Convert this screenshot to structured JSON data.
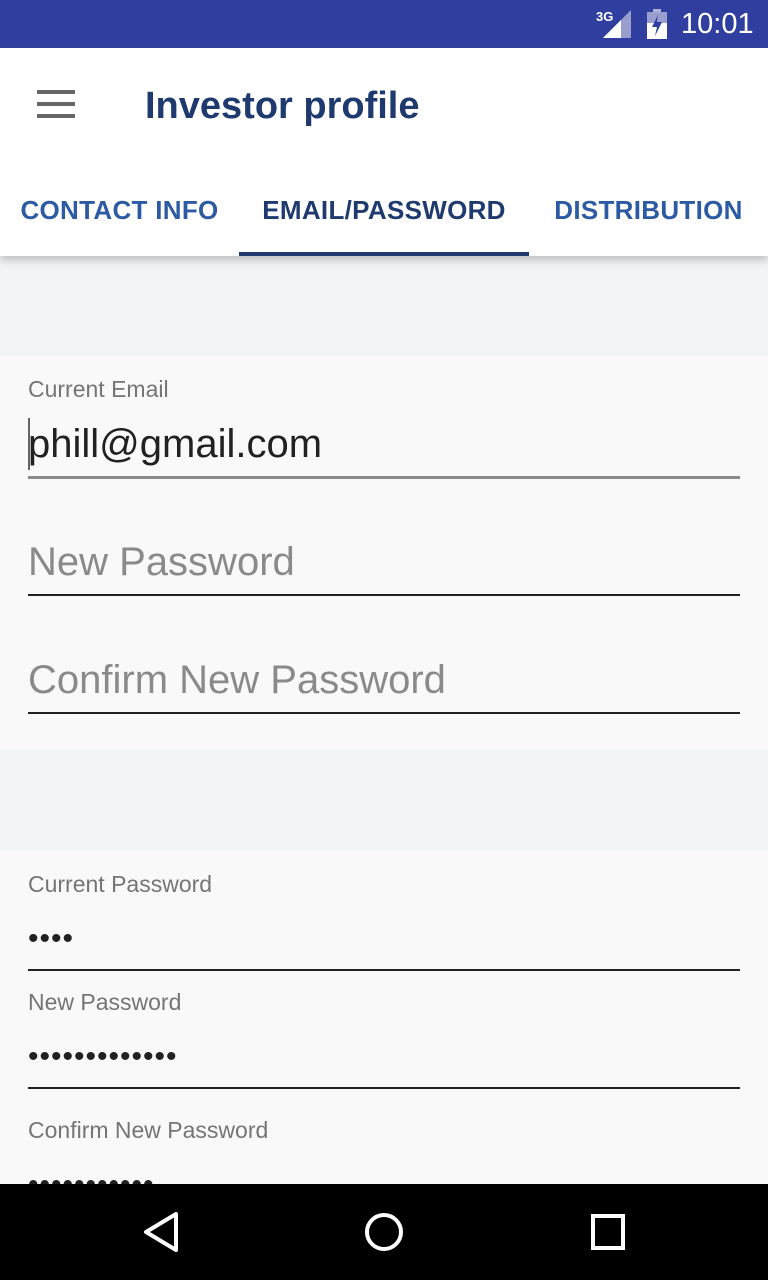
{
  "status_bar": {
    "network": "3G",
    "time": "10:01"
  },
  "app_bar": {
    "title": "Investor profile",
    "menu_icon": "hamburger-menu-icon"
  },
  "tabs": [
    {
      "label": "CONTACT INFO",
      "active": false
    },
    {
      "label": "EMAIL/PASSWORD",
      "active": true
    },
    {
      "label": "DISTRIBUTION",
      "active": false
    }
  ],
  "email_section": {
    "current_email_label": "Current Email",
    "current_email_value": "phill@gmail.com",
    "new_password_placeholder": "New Password",
    "confirm_new_password_placeholder": "Confirm New Password"
  },
  "password_section": {
    "current_password_label": "Current Password",
    "current_password_value": "••••",
    "new_password_label": "New Password",
    "new_password_value": "•••••••••••••",
    "confirm_new_password_label": "Confirm New Password",
    "confirm_new_password_value": "•••••••••••"
  },
  "nav_bar": {
    "back_icon": "back-triangle-icon",
    "home_icon": "home-circle-icon",
    "recents_icon": "recents-square-icon"
  },
  "colors": {
    "status_bar": "#303f9f",
    "title": "#1f3a6e",
    "tab_text": "#2c5ba3",
    "background": "#f9f9f9"
  }
}
